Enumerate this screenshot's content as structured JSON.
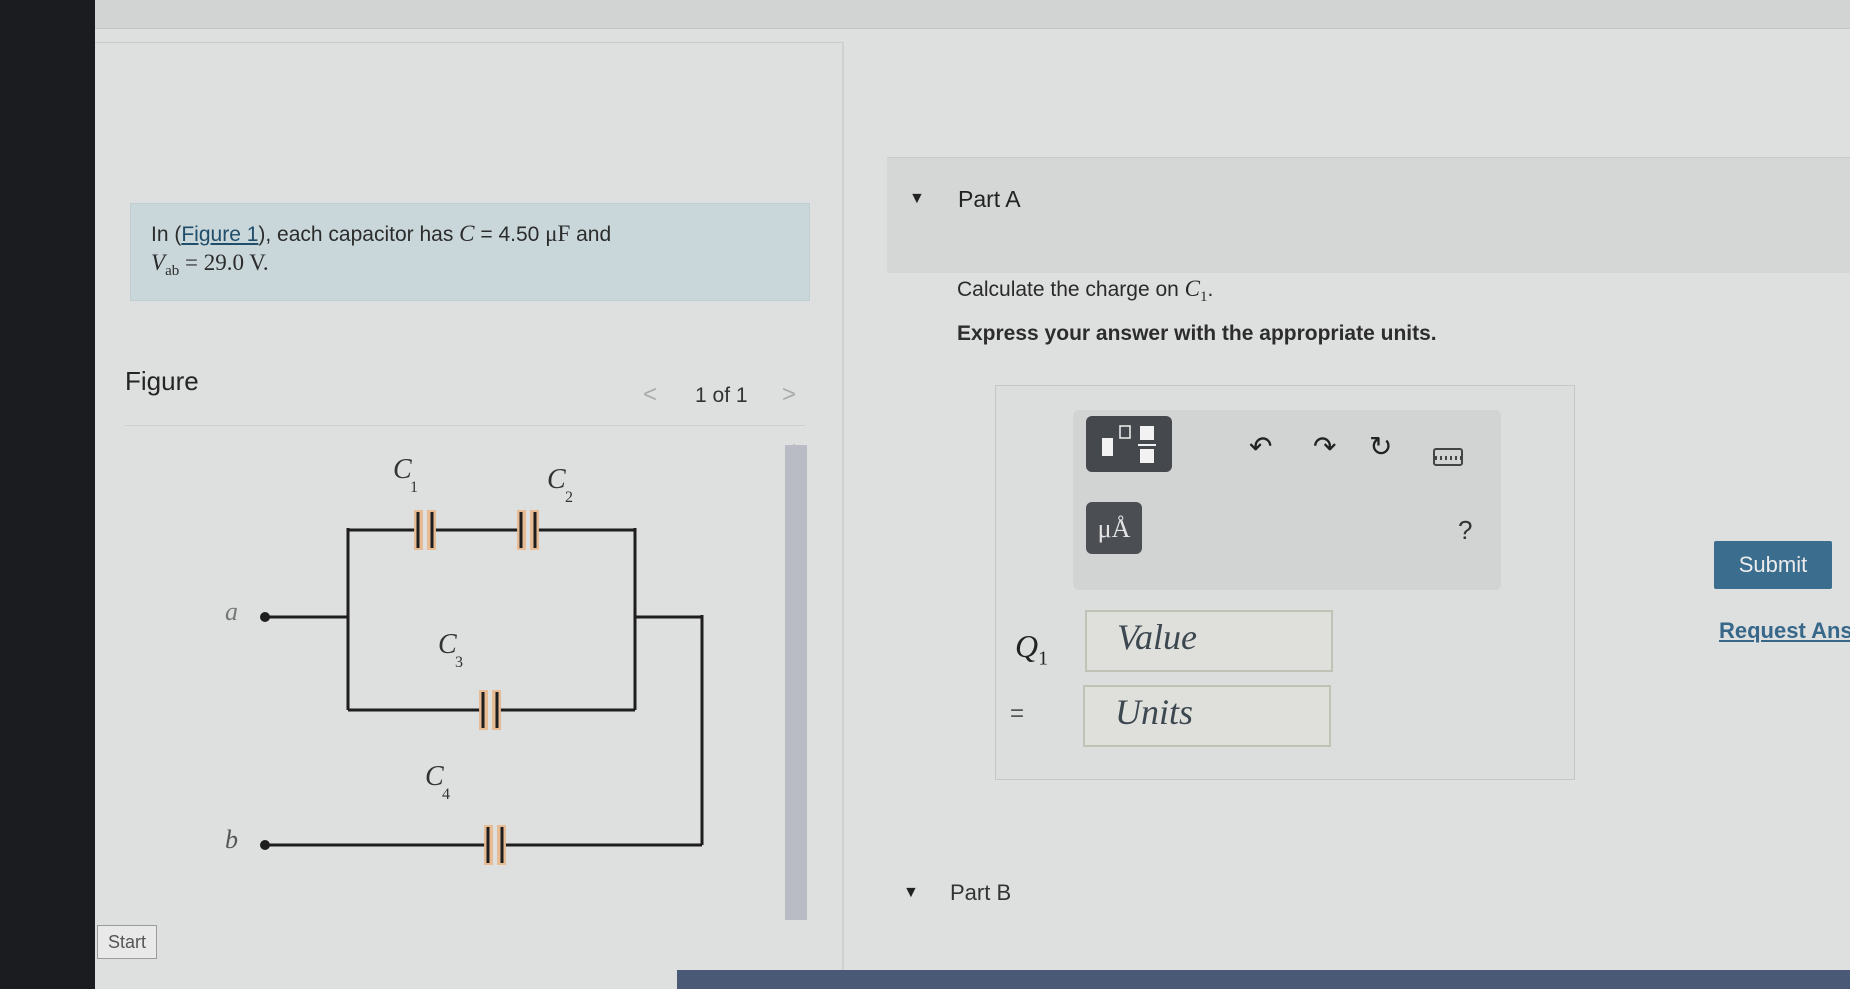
{
  "problem": {
    "intro": "In (",
    "figure_link": "Figure 1",
    "mid": "), each capacitor has ",
    "c_expr": "C",
    "c_value": " = 4.50 ",
    "c_unit": "μF",
    "and": " and",
    "v_symbol": "V",
    "v_sub": "ab",
    "v_value": " = 29.0 V."
  },
  "figure": {
    "heading": "Figure",
    "prev_glyph": "<",
    "page_indicator": "1 of 1",
    "next_glyph": ">",
    "labels": {
      "c1": "C",
      "c1_sub": "1",
      "c2": "C",
      "c2_sub": "2",
      "c3": "C",
      "c3_sub": "3",
      "c4": "C",
      "c4_sub": "4",
      "node_a": "a",
      "node_b": "b"
    }
  },
  "part_a": {
    "title": "Part A",
    "question_pre": "Calculate the charge on ",
    "question_var": "C",
    "question_sub": "1",
    "question_post": ".",
    "instructions": "Express your answer with the appropriate units.",
    "unit_button": "μÅ",
    "help": "?",
    "answer_var": "Q",
    "answer_sub": "1",
    "equals": "=",
    "value_placeholder": "Value",
    "units_placeholder": "Units",
    "submit": "Submit",
    "request_answer": "Request Answer"
  },
  "part_b": {
    "title": "Part B"
  },
  "taskbar": {
    "start": "Start"
  },
  "colors": {
    "accent": "#3a6d8e",
    "capacitor_highlight": "#e8b98e"
  },
  "icons": [
    "undo-icon",
    "redo-icon",
    "reset-icon",
    "keyboard-icon",
    "caret-down-icon"
  ]
}
